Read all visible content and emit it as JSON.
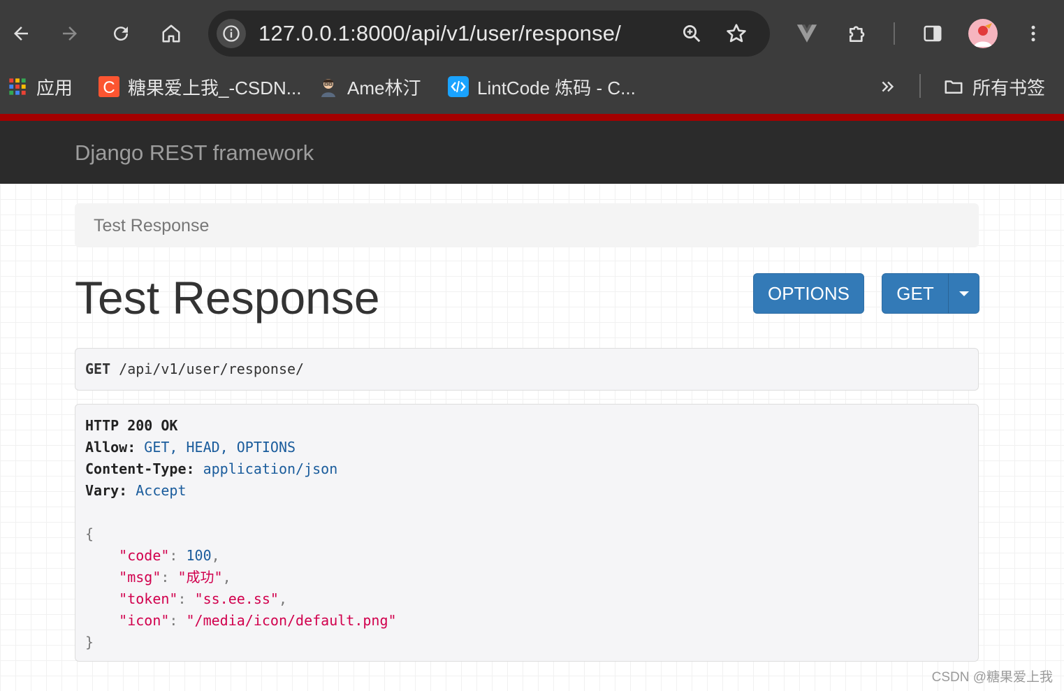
{
  "browser": {
    "url": "127.0.0.1:8000/api/v1/user/response/",
    "bookmarks": [
      {
        "label": "应用",
        "icon": "apps-grid-icon"
      },
      {
        "label": "糖果爱上我_-CSDN...",
        "icon": "csdn-logo-icon"
      },
      {
        "label": "Ame林汀",
        "icon": "avatar-icon"
      },
      {
        "label": "LintCode 炼码 - C...",
        "icon": "lintcode-logo-icon"
      }
    ],
    "all_bookmarks_label": "所有书签"
  },
  "navbar": {
    "brand": "Django REST framework",
    "accent_color": "#a30000"
  },
  "breadcrumb": {
    "item": "Test Response"
  },
  "page": {
    "title": "Test Response",
    "options_button": "OPTIONS",
    "get_button": "GET"
  },
  "request": {
    "method": "GET",
    "path": "/api/v1/user/response/"
  },
  "response": {
    "status_line": "HTTP 200 OK",
    "headers": [
      {
        "key": "Allow:",
        "value": "GET, HEAD, OPTIONS"
      },
      {
        "key": "Content-Type:",
        "value": "application/json"
      },
      {
        "key": "Vary:",
        "value": "Accept"
      }
    ],
    "body": {
      "open": "{",
      "close": "}",
      "fields": [
        {
          "key": "\"code\"",
          "value": "100",
          "type": "num",
          "sep": ","
        },
        {
          "key": "\"msg\"",
          "value": "\"成功\"",
          "type": "str",
          "sep": ","
        },
        {
          "key": "\"token\"",
          "value": "\"ss.ee.ss\"",
          "type": "str",
          "sep": ","
        },
        {
          "key": "\"icon\"",
          "value": "\"/media/icon/default.png\"",
          "type": "str",
          "sep": ""
        }
      ]
    }
  },
  "watermark": "CSDN @糖果爱上我"
}
